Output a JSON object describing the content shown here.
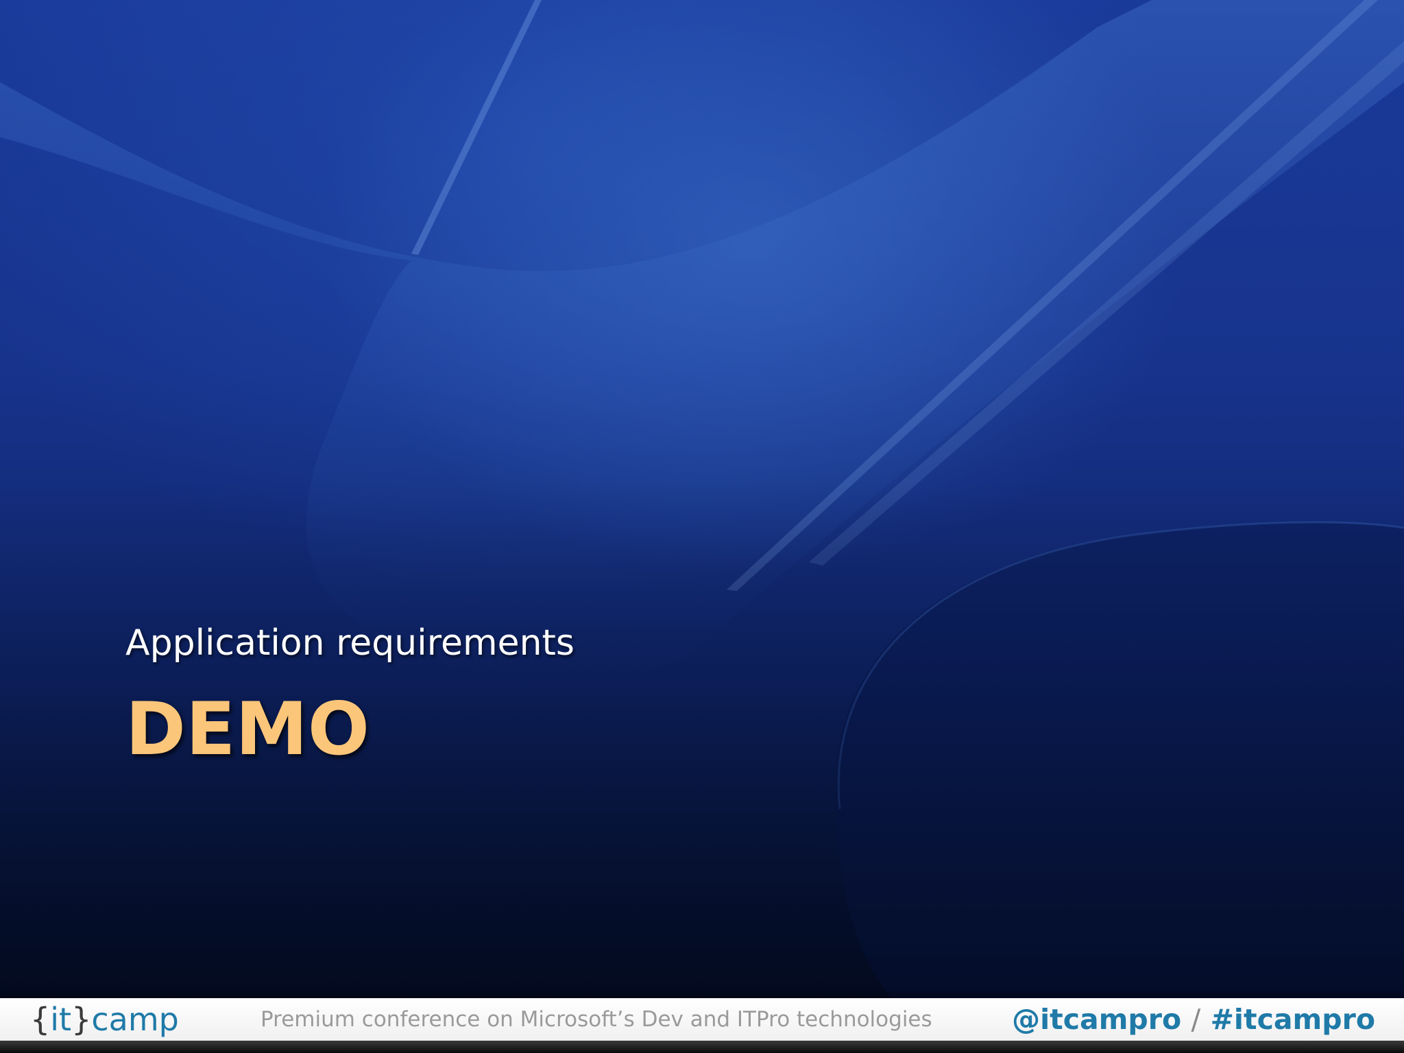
{
  "slide": {
    "subtitle": "Application requirements",
    "title": "DEMO"
  },
  "footer": {
    "logo": {
      "open_brace": "{",
      "it": "it",
      "close_brace": "}",
      "camp": "camp"
    },
    "tagline": "Premium conference on Microsoft’s Dev and ITPro technologies",
    "social": {
      "handle": "@itcampro",
      "separator": "/",
      "hashtag": "#itcampro"
    }
  },
  "colors": {
    "title": "#fbc67a",
    "subtitle": "#ffffff",
    "brand": "#1f7aa8",
    "tagline": "#9a9a9a"
  }
}
